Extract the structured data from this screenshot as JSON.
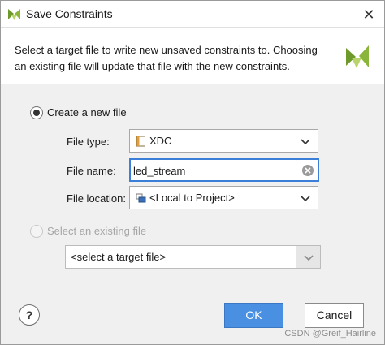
{
  "window": {
    "title": "Save Constraints",
    "close_glyph": "✕"
  },
  "header": {
    "description": "Select a target file to write new unsaved constraints to. Choosing an existing file will update that file with the new constraints."
  },
  "create_new": {
    "label": "Create a new file",
    "selected": true,
    "file_type": {
      "label": "File type:",
      "value": "XDC",
      "icon": "file-icon"
    },
    "file_name": {
      "label": "File name:",
      "value": "led_stream"
    },
    "file_location": {
      "label": "File location:",
      "value": "<Local to Project>",
      "icon": "location-icon"
    }
  },
  "select_existing": {
    "label": "Select an existing file",
    "selected": false,
    "disabled": true,
    "target_file_value": "<select a target file>"
  },
  "buttons": {
    "help": "?",
    "ok": "OK",
    "cancel": "Cancel"
  },
  "watermark": "CSDN @Greif_Hairline",
  "colors": {
    "ok_accent": "#4a90e2",
    "focus_border": "#3c7fd8",
    "logo_green": "#8bb43a"
  }
}
